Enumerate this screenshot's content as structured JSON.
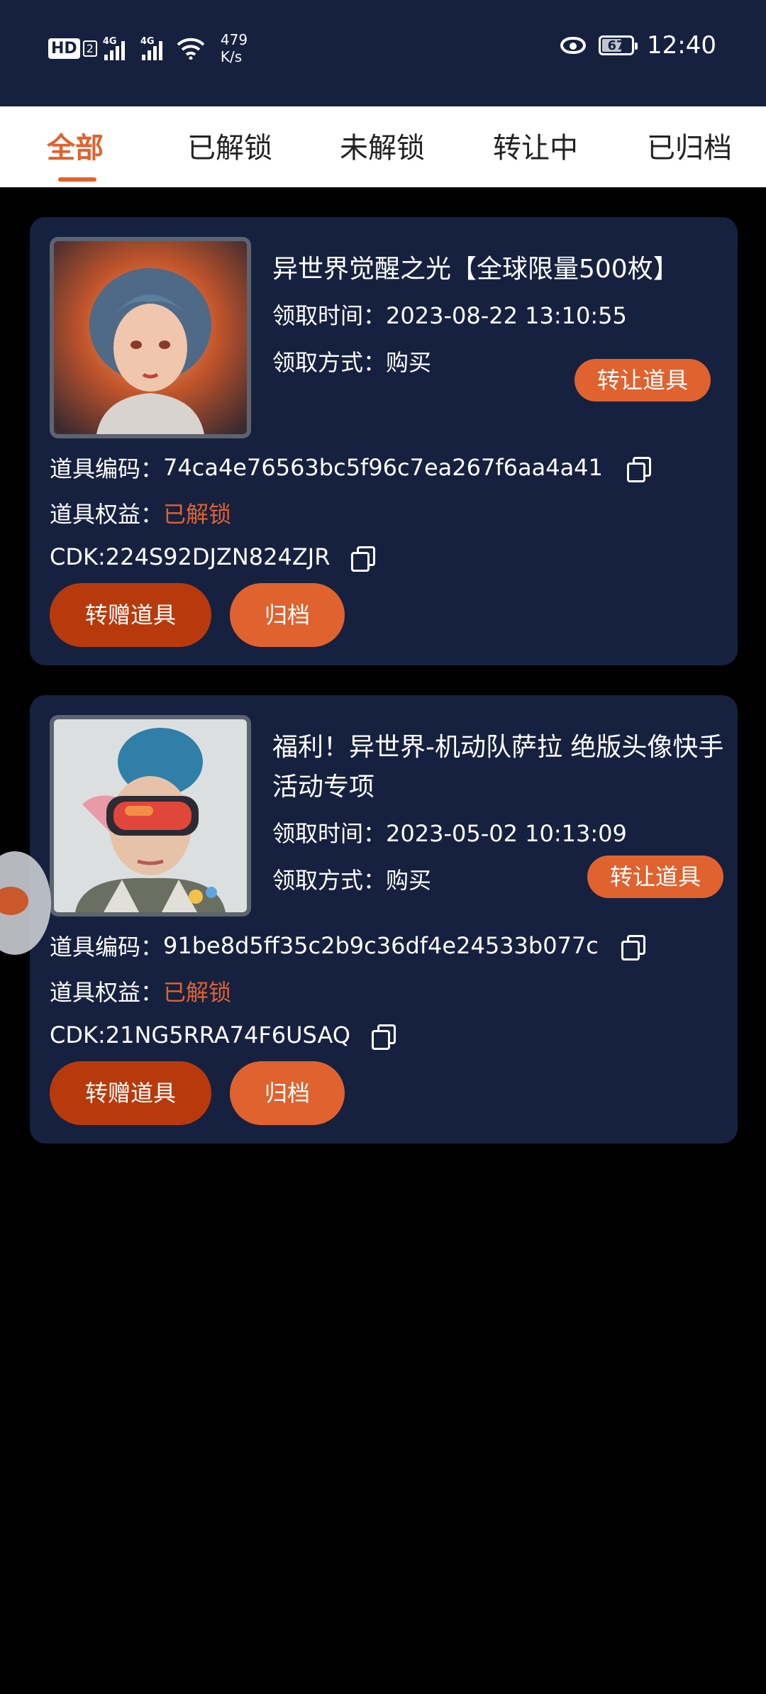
{
  "status_bar": {
    "hd_label": "HD",
    "sim2_label": "2",
    "network1": "4G",
    "network2": "4G",
    "speed_value": "479",
    "speed_unit": "K/s",
    "battery": "67",
    "time": "12:40"
  },
  "tabs": [
    {
      "label": "全部",
      "active": true
    },
    {
      "label": "已解锁",
      "active": false
    },
    {
      "label": "未解锁",
      "active": false
    },
    {
      "label": "转让中",
      "active": false
    },
    {
      "label": "已归档",
      "active": false
    }
  ],
  "items": [
    {
      "title": "异世界觉醒之光【全球限量500枚】",
      "time_label": "领取时间：",
      "time": "2023-08-22 13:10:55",
      "method_label": "领取方式：",
      "method": "购买",
      "transfer_label": "转让道具",
      "code_label": "道具编码：",
      "code": "74ca4e76563bc5f96c7ea267f6aa4a41",
      "rights_label": "道具权益：",
      "rights": "已解锁",
      "cdk": "CDK:224S92DJZN824ZJR",
      "gift_label": "转赠道具",
      "archive_label": "归档"
    },
    {
      "title": "福利！异世界-机动队萨拉 绝版头像快手活动专项",
      "time_label": "领取时间：",
      "time": "2023-05-02 10:13:09",
      "method_label": "领取方式：",
      "method": "购买",
      "transfer_label": "转让道具",
      "code_label": "道具编码：",
      "code": "91be8d5ff35c2b9c36df4e24533b077c",
      "rights_label": "道具权益：",
      "rights": "已解锁",
      "cdk": "CDK:21NG5RRA74F6USAQ",
      "gift_label": "转赠道具",
      "archive_label": "归档"
    }
  ],
  "colors": {
    "accent": "#e0622f",
    "card_bg": "#16213f",
    "gift_button": "#b83a0c",
    "page_bg": "#000000"
  }
}
